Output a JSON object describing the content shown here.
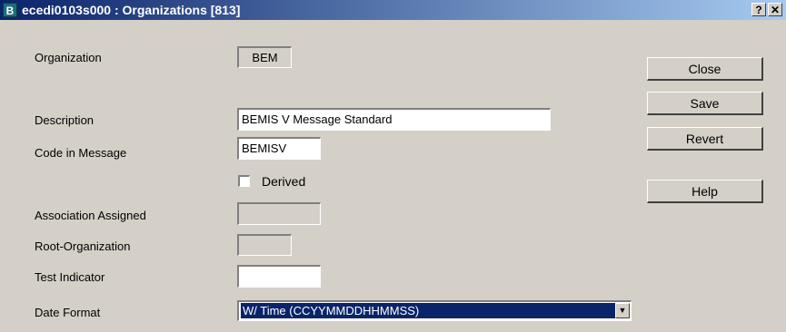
{
  "window": {
    "title": "ecedi0103s000 : Organizations [813]",
    "app_icon": "B",
    "help_button": "?",
    "close_button": "✕"
  },
  "form": {
    "organization": {
      "label": "Organization",
      "value": "BEM"
    },
    "description": {
      "label": "Description",
      "value": "BEMIS V Message Standard"
    },
    "code_in_message": {
      "label": "Code in Message",
      "value": "BEMISV"
    },
    "derived": {
      "label": "Derived",
      "checked": false
    },
    "association_assigned": {
      "label": "Association Assigned",
      "value": ""
    },
    "root_organization": {
      "label": "Root-Organization",
      "value": ""
    },
    "test_indicator": {
      "label": "Test Indicator",
      "value": ""
    },
    "date_format": {
      "label": "Date Format",
      "value": "W/ Time (CCYYMMDDHHMMSS)"
    }
  },
  "buttons": {
    "close": "Close",
    "save": "Save",
    "revert": "Revert",
    "help": "Help"
  },
  "colors": {
    "title_gradient_start": "#0a246a",
    "title_gradient_end": "#a6caf0",
    "dialog_background": "#d4d0c8",
    "selection": "#0a246a"
  },
  "icons": {
    "app": "baan-app-icon",
    "help": "question-icon",
    "close": "close-icon",
    "dropdown": "chevron-down-icon"
  }
}
